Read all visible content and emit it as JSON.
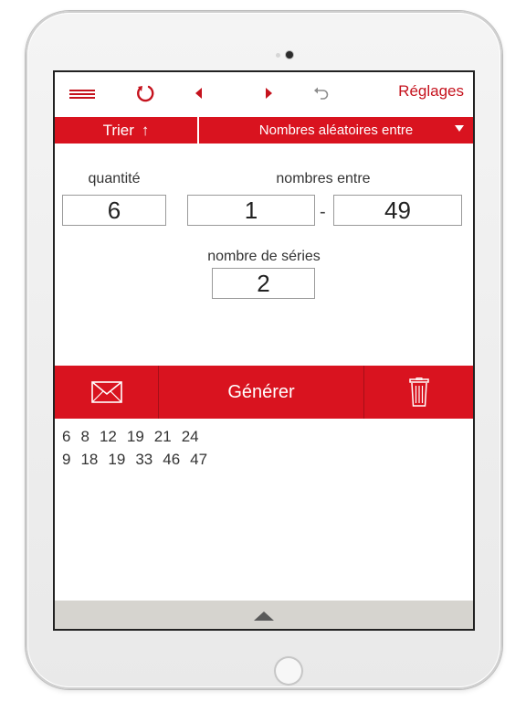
{
  "toolbar": {
    "settings_label": "Réglages",
    "icons": [
      "menu-icon",
      "refresh-icon",
      "chevron-left-icon",
      "chevron-right-icon",
      "undo-icon"
    ]
  },
  "mode_bar": {
    "sort_label": "Trier",
    "sort_arrow": "↑",
    "mode_label": "Nombres aléatoires entre"
  },
  "form": {
    "quantity_label": "quantité",
    "quantity_value": "6",
    "range_label": "nombres entre",
    "range_min": "1",
    "range_separator": "-",
    "range_max": "49",
    "series_label": "nombre de séries",
    "series_value": "2"
  },
  "actions": {
    "generate_label": "Générer"
  },
  "results": [
    [
      "6",
      "8",
      "12",
      "19",
      "21",
      "24"
    ],
    [
      "9",
      "18",
      "19",
      "33",
      "46",
      "47"
    ]
  ],
  "colors": {
    "accent": "#d9131f",
    "accent_text": "#c5121d",
    "bottom_bar": "#d6d4cf"
  }
}
